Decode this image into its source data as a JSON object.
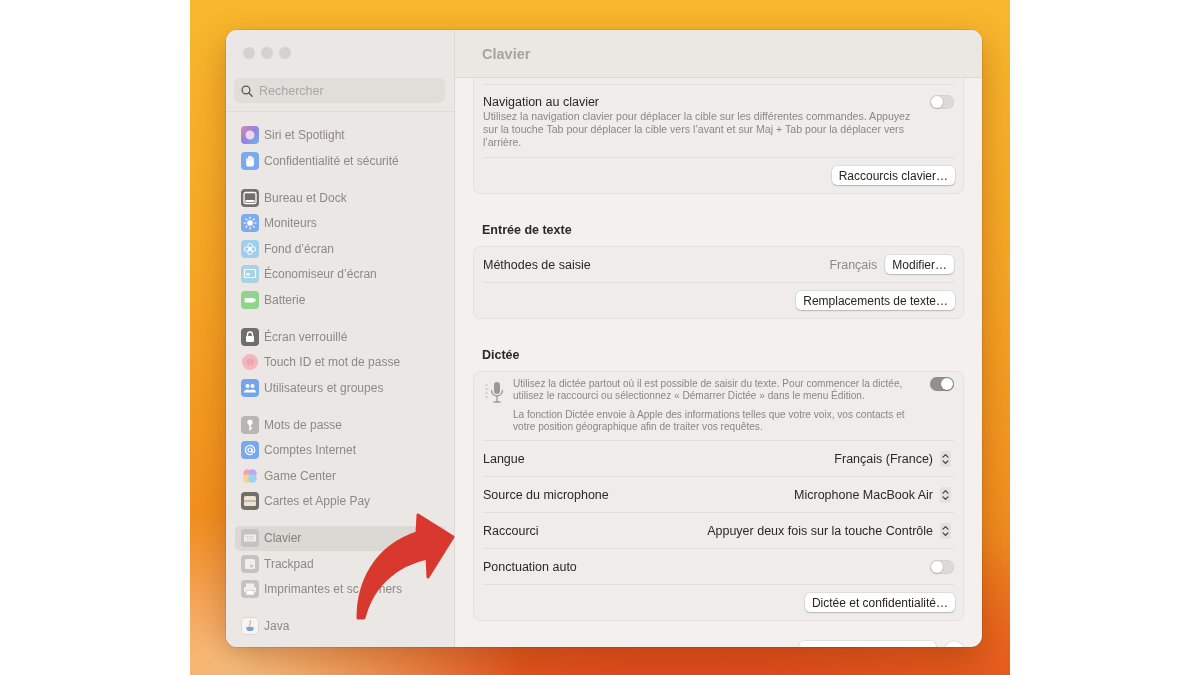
{
  "window": {
    "title": "Clavier"
  },
  "sidebar": {
    "search": {
      "placeholder": "Rechercher"
    },
    "groups": [
      {
        "items": [
          {
            "label": "Siri et Spotlight",
            "selected": false
          },
          {
            "label": "Confidentialité et sécurité",
            "selected": false
          }
        ]
      },
      {
        "items": [
          {
            "label": "Bureau et Dock",
            "selected": false
          },
          {
            "label": "Moniteurs",
            "selected": false
          },
          {
            "label": "Fond d’écran",
            "selected": false
          },
          {
            "label": "Économiseur d’écran",
            "selected": false
          },
          {
            "label": "Batterie",
            "selected": false
          }
        ]
      },
      {
        "items": [
          {
            "label": "Écran verrouillé",
            "selected": false
          },
          {
            "label": "Touch ID et mot de passe",
            "selected": false
          },
          {
            "label": "Utilisateurs et groupes",
            "selected": false
          }
        ]
      },
      {
        "items": [
          {
            "label": "Mots de passe",
            "selected": false
          },
          {
            "label": "Comptes Internet",
            "selected": false
          },
          {
            "label": "Game Center",
            "selected": false
          },
          {
            "label": "Cartes et Apple Pay",
            "selected": false
          }
        ]
      },
      {
        "items": [
          {
            "label": "Clavier",
            "selected": true
          },
          {
            "label": "Trackpad",
            "selected": false
          },
          {
            "label": "Imprimantes et sc",
            "label_end": "ners",
            "selected": false
          }
        ]
      },
      {
        "items": [
          {
            "label": "Java",
            "selected": false
          }
        ]
      }
    ]
  },
  "sections": [
    {
      "rows": [
        {
          "kind": "toggle",
          "label": "Navigation au clavier",
          "description": "Utilisez la navigation clavier pour déplacer la cible sur les différentes commandes. Appuyez sur la touche Tab pour déplacer la cible vers l’avant et sur Maj + Tab pour la déplacer vers l’arrière.",
          "on": false
        },
        {
          "kind": "button",
          "button": "Raccourcis clavier…"
        }
      ]
    },
    {
      "heading": "Entrée de texte",
      "rows": [
        {
          "kind": "value_button",
          "label": "Méthodes de saisie",
          "value": "Français",
          "button": "Modifier…"
        },
        {
          "kind": "button",
          "button": "Remplacements de texte…"
        }
      ]
    },
    {
      "heading": "Dictée",
      "rows": [
        {
          "kind": "info_toggle",
          "paragraphs": [
            "Utilisez la dictée partout où il est possible de saisir du texte. Pour commencer la dictée, utilisez le raccourci ou sélectionnez « Démarrer Dictée » dans le menu Édition.",
            "La fonction Dictée envoie à Apple des informations telles que votre voix, vos contacts et votre position géographique afin de traiter vos requêtes."
          ],
          "on": true
        },
        {
          "kind": "popup",
          "label": "Langue",
          "value": "Français (France)"
        },
        {
          "kind": "popup",
          "label": "Source du microphone",
          "value": "Microphone MacBook Air"
        },
        {
          "kind": "popup",
          "label": "Raccourci",
          "value": "Appuyer deux fois sur la touche Contrôle"
        },
        {
          "kind": "toggle",
          "label": "Ponctuation auto",
          "on": false
        },
        {
          "kind": "button",
          "button": "Dictée et confidentialité…"
        }
      ]
    }
  ]
}
